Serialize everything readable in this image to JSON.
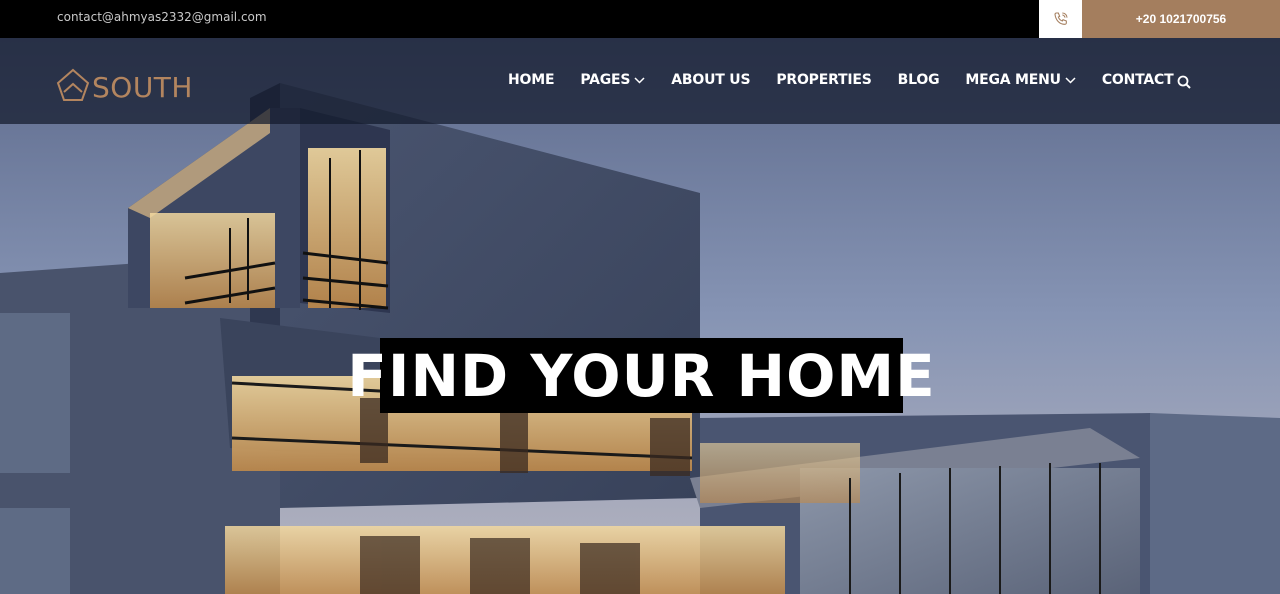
{
  "topbar": {
    "email": "contact@ahmyas2332@gmail.com",
    "phone": "+20 1021700756",
    "phone_icon": "phone-icon"
  },
  "nav": {
    "logo_text": "SOUTH",
    "logo_icon": "house-outline-icon",
    "items": [
      {
        "label": "HOME",
        "dropdown": false
      },
      {
        "label": "PAGES",
        "dropdown": true
      },
      {
        "label": "ABOUT US",
        "dropdown": false
      },
      {
        "label": "PROPERTIES",
        "dropdown": false
      },
      {
        "label": "BLOG",
        "dropdown": false
      },
      {
        "label": "MEGA MENU",
        "dropdown": true
      },
      {
        "label": "CONTACT",
        "dropdown": false
      }
    ],
    "search_icon": "search-icon"
  },
  "hero": {
    "headline": "FIND YOUR HOME"
  },
  "colors": {
    "accent": "#a47e5e",
    "topbar_bg": "#000000",
    "navbar_bg": "#141a2c"
  }
}
